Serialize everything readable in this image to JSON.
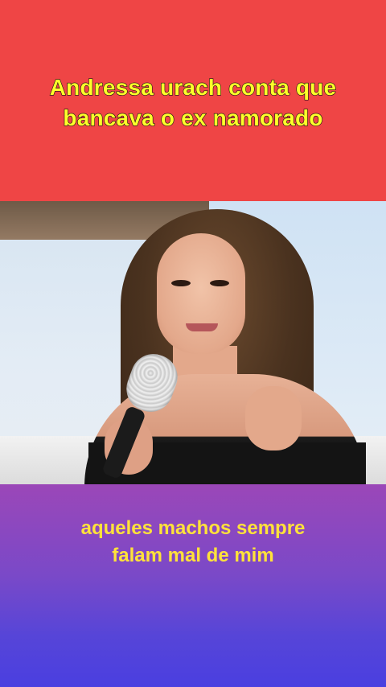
{
  "headline": {
    "line1": "Andressa urach conta que",
    "line2": "bancava o ex namorado"
  },
  "caption": {
    "line1": "aqueles machos sempre",
    "line2": "falam mal de mim"
  },
  "colors": {
    "top_banner": "#ef4545",
    "headline_text": "#ffff2a",
    "caption_text": "#ffe23a",
    "bottom_gradient_top": "#9b47b8",
    "bottom_gradient_bottom": "#4a3fe0"
  },
  "video": {
    "subject": "woman-speaking-into-microphone"
  }
}
